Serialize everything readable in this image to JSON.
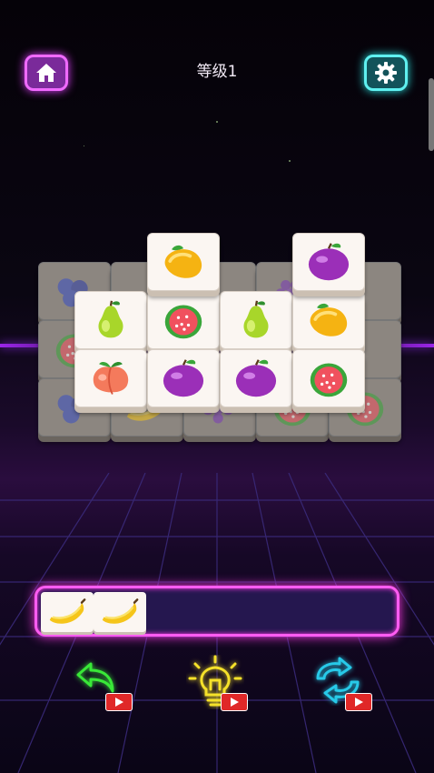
{
  "header": {
    "level_label": "等级1",
    "home_icon": "home-icon",
    "settings_icon": "gear-icon"
  },
  "board": {
    "top_layer": [
      {
        "fruit": "mango"
      },
      {
        "fruit": "plum"
      }
    ],
    "middle_layer_row1": [
      {
        "fruit": "pear"
      },
      {
        "fruit": "guava"
      },
      {
        "fruit": "pear"
      },
      {
        "fruit": "mango"
      }
    ],
    "middle_layer_row2": [
      {
        "fruit": "peach"
      },
      {
        "fruit": "plum"
      },
      {
        "fruit": "plum"
      },
      {
        "fruit": "guava"
      }
    ],
    "bottom_layer_visible": [
      "blueberry",
      "blueberry",
      "guava",
      "grapes",
      "guava",
      "guava",
      "blueberry",
      "banana",
      "grapes"
    ]
  },
  "tray": {
    "capacity": 7,
    "tiles": [
      {
        "fruit": "banana"
      },
      {
        "fruit": "banana"
      }
    ]
  },
  "tools": [
    {
      "name": "undo",
      "icon": "undo-arrow-icon",
      "color": "#39e838",
      "video_ad": true
    },
    {
      "name": "hint",
      "icon": "lightbulb-icon",
      "color": "#f5e12a",
      "video_ad": true
    },
    {
      "name": "shuffle",
      "icon": "shuffle-icon",
      "color": "#27c9e8",
      "video_ad": true
    }
  ],
  "colors": {
    "tray_border": "#ff5cf2",
    "home_border": "#f06aff",
    "settings_border": "#5ff0f0"
  }
}
